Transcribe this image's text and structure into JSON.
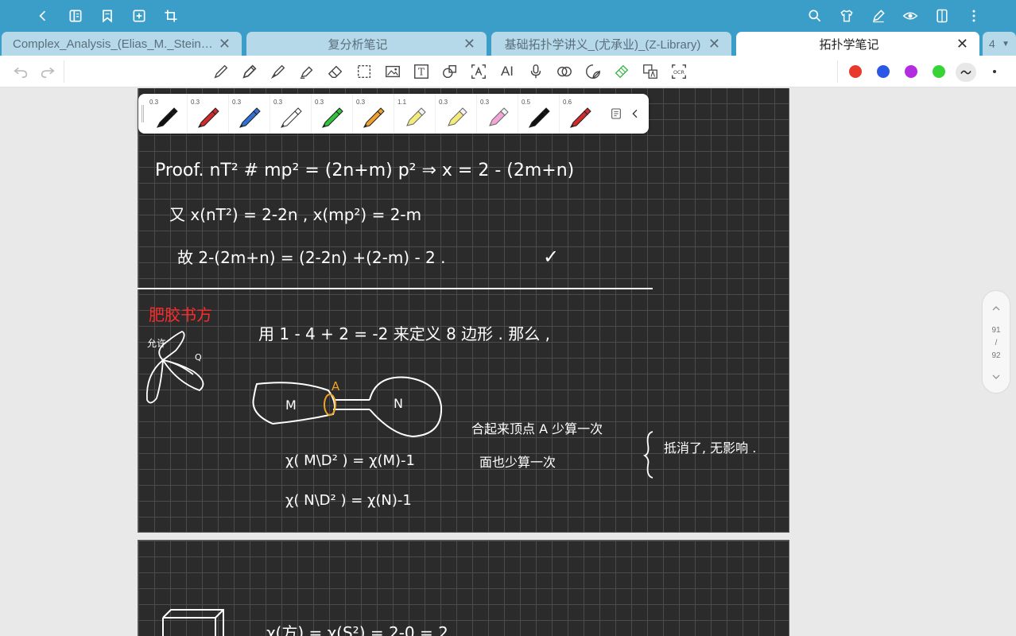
{
  "topbar": {
    "left_icons": [
      "back-icon",
      "book-icon",
      "bookmark-icon",
      "add-page-icon",
      "crop-icon"
    ],
    "right_icons": [
      "search-icon",
      "shirt-icon",
      "pen-edit-icon",
      "eye-icon",
      "page-layout-icon",
      "more-vert-icon"
    ]
  },
  "tabs": [
    {
      "label": "Complex_Analysis_(Elias_M._Stein,_...",
      "active": false
    },
    {
      "label": "复分析笔记",
      "active": false
    },
    {
      "label": "基础拓扑学讲义_(尤承业)_(Z-Library)",
      "active": false
    },
    {
      "label": "拓扑学笔记",
      "active": true
    }
  ],
  "tab_overflow": "4",
  "tab_close": "✕",
  "toolbar": {
    "tools": [
      "pen-icon",
      "pencil-icon",
      "fountain-pen-icon",
      "highlighter-icon",
      "eraser-icon",
      "lasso-select-icon",
      "image-icon",
      "text-box-icon",
      "shape-icon",
      "text-recognize-icon",
      "ai-icon",
      "microphone-icon",
      "link-icon",
      "sticker-icon",
      "tape-icon",
      "translate-icon",
      "ocr-icon"
    ],
    "ai_label": "AI",
    "ocr_label": "OCR",
    "text_label": "T",
    "colors": [
      "#e8392d",
      "#2b57e6",
      "#b22ce0",
      "#37d337"
    ]
  },
  "pens": [
    {
      "size": "0.3",
      "color": "#111111",
      "kind": "pen"
    },
    {
      "size": "0.3",
      "color": "#d12a2a",
      "kind": "pen"
    },
    {
      "size": "0.3",
      "color": "#2f6fd6",
      "kind": "pen"
    },
    {
      "size": "0.3",
      "color": "#ffffff",
      "kind": "pen"
    },
    {
      "size": "0.3",
      "color": "#2fc43a",
      "kind": "pen"
    },
    {
      "size": "0.3",
      "color": "#f0a030",
      "kind": "pen"
    },
    {
      "size": "1.1",
      "color": "#f3ec7a",
      "kind": "marker"
    },
    {
      "size": "0.3",
      "color": "#f3ec7a",
      "kind": "marker"
    },
    {
      "size": "0.3",
      "color": "#f2a6d8",
      "kind": "marker"
    },
    {
      "size": "0.5",
      "color": "#111111",
      "kind": "pen"
    },
    {
      "size": "0.6",
      "color": "#d12a2a",
      "kind": "pen"
    }
  ],
  "page_indicator": {
    "current": "91",
    "separator": "/",
    "total": "92"
  },
  "notes": {
    "line1": "Proof.   nT² # mp² = (2n+m) p²  ⇒  x =  2 - (2m+n)",
    "line2": "又   x(nT²) = 2-2n ,     x(mp²) = 2-m",
    "line3": "故  2-(2m+n) = (2-2n) +(2-m) - 2 .",
    "check": "✓",
    "heading_red": "肥胶书方",
    "petal_label": "允许",
    "petal_small": "Q",
    "main_line": "用 1 - 4 + 2 = -2 来定义 8 边形 .     那么 ,",
    "label_A": "A",
    "label_M": "M",
    "label_N": "N",
    "eq_m": "χ( M\\D² ) = χ(M)-1",
    "eq_n": "χ( N\\D² ) = χ(N)-1",
    "note1": "合起来顶点 A 少算一次",
    "note2": "面也少算一次",
    "brace_note": "抵消了, 无影响 .",
    "bottom_eq": "χ(方) = χ(S²) = 2-0 = 2"
  }
}
